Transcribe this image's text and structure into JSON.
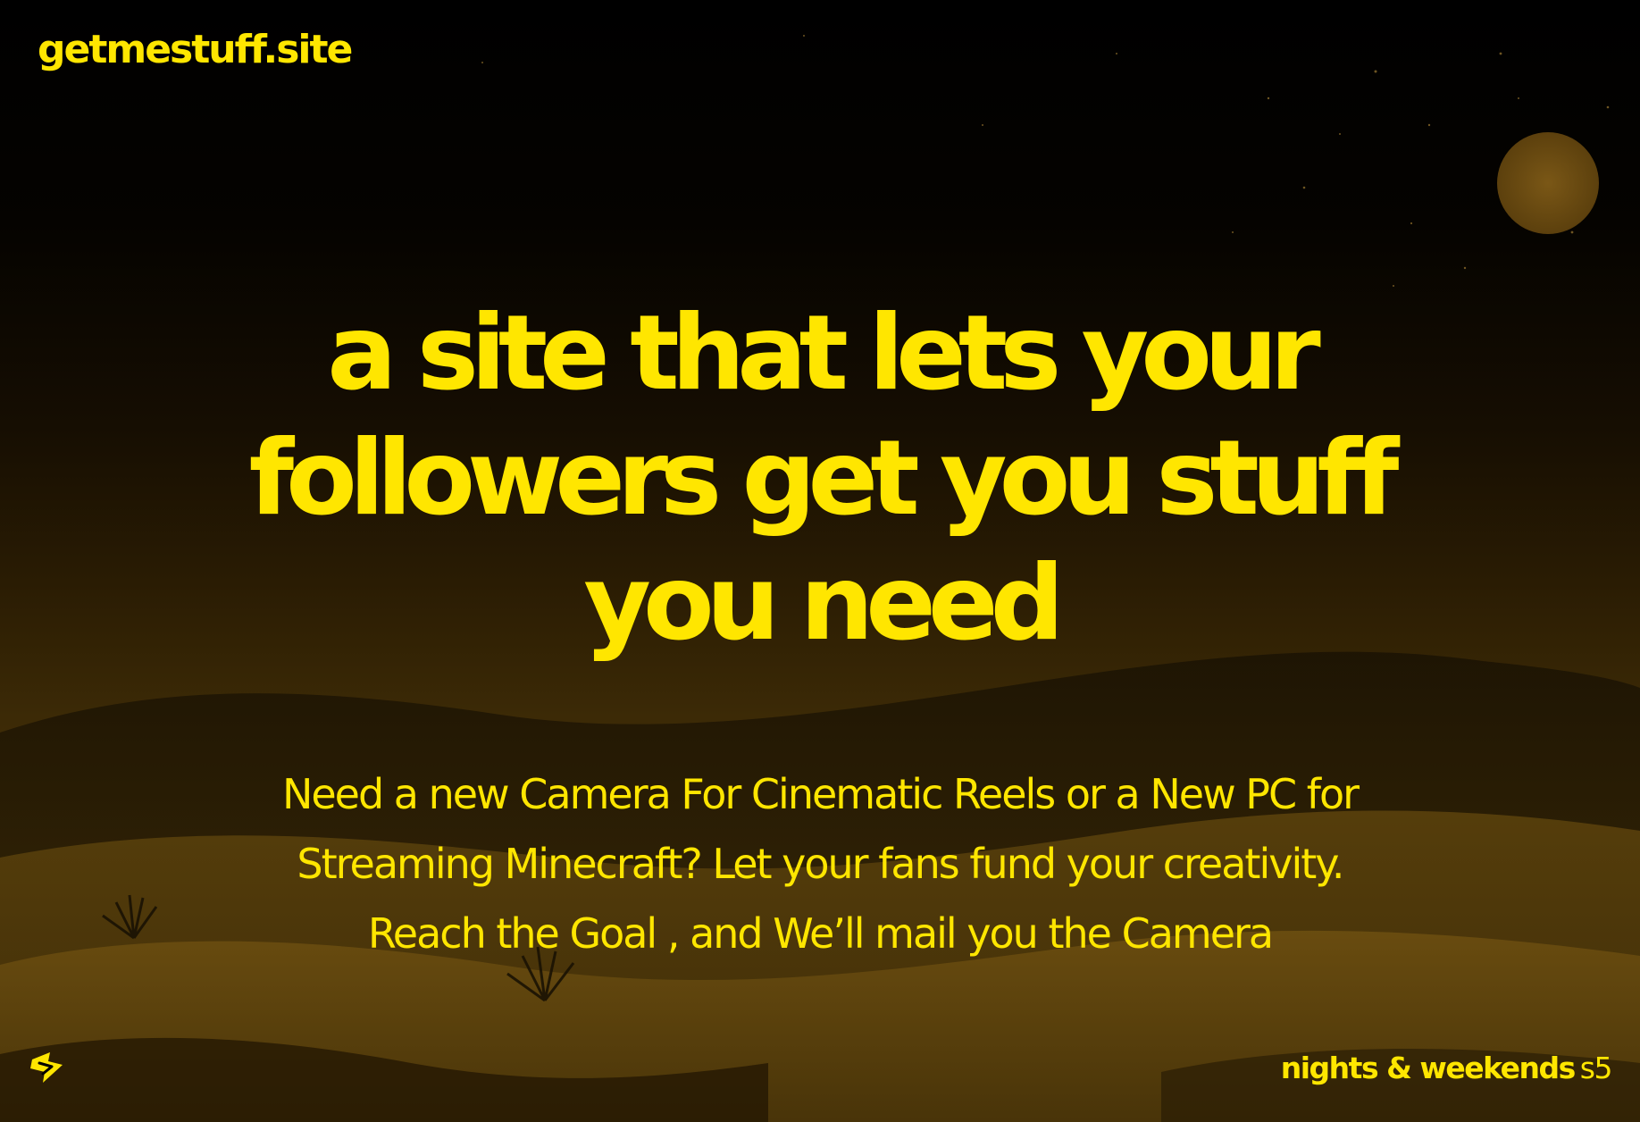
{
  "site": {
    "logo_text": "getmestuff.site"
  },
  "hero": {
    "headline_lines": [
      "a site that lets your",
      "followers get you stuff",
      "you need"
    ],
    "subtext_lines": [
      "Need a new Camera For Cinematic Reels or a New PC for",
      "Streaming Minecraft?  Let your fans fund your creativity.",
      "Reach the Goal , and We’ll mail you the Camera"
    ]
  },
  "footer": {
    "brand": "nights & weekends",
    "season": "s5",
    "icon": "bolt-badge-icon"
  },
  "colors": {
    "accent": "#ffe600",
    "background": "#000000",
    "moon": "#6a4a12",
    "dunes_dark": "#1f1503",
    "dunes_light": "#6e4f10"
  }
}
